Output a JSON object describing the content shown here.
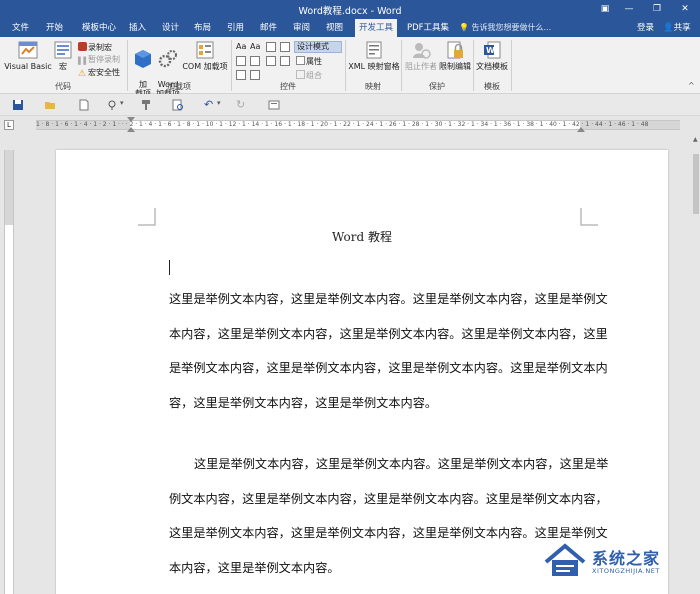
{
  "window": {
    "title": "Word教程.docx - Word"
  },
  "tabs": [
    {
      "label": "文件"
    },
    {
      "label": "开始"
    },
    {
      "label": "模板中心"
    },
    {
      "label": "插入"
    },
    {
      "label": "设计"
    },
    {
      "label": "布局"
    },
    {
      "label": "引用"
    },
    {
      "label": "邮件"
    },
    {
      "label": "审阅"
    },
    {
      "label": "视图"
    },
    {
      "label": "开发工具"
    },
    {
      "label": "PDF工具集"
    }
  ],
  "active_tab": "开发工具",
  "tell_me": "告诉我您想要做什么...",
  "account": {
    "login": "登录",
    "share": "共享"
  },
  "ribbon": {
    "code": {
      "label": "代码",
      "visual_basic": "Visual Basic",
      "macros": "宏",
      "record_macro": "录制宏",
      "pause_recording": "暂停录制",
      "macro_security": "宏安全性"
    },
    "addins": {
      "label": "加载项",
      "addins": "加\n载项",
      "word_addins": "Word\n加载项",
      "com_addins": "COM 加载项"
    },
    "controls": {
      "label": "控件",
      "design_mode": "设计模式",
      "properties": "属性",
      "group": "组合"
    },
    "mapping": {
      "label": "映射",
      "xml_mapping": "XML 映射窗格"
    },
    "protect": {
      "label": "保护",
      "block_authors": "阻止作者",
      "restrict_editing": "限制编辑"
    },
    "templates": {
      "label": "模板",
      "document_template": "文档模板"
    }
  },
  "ruler": {
    "h_ticks": "1 · 8 · 1 · 6 · 1 · 4 · 1 · 2 · 1 · · · 2 · 1 · 4 · 1 · 6 · 1 · 8 · 1 · 10 · 1 · 12 · 1 · 14 · 1 · 16 · 1 · 18 · 1 · 20 · 1 · 22 · 1 · 24 · 1 · 26 · 1 · 28 · 1 · 30 · 1 · 32 · 1 · 34 · 1 · 36 · 1 · 38 · 1 · 40 · 1 · 42 · 1 · 44 · 1 · 46 · 1 · 48",
    "corner": "L"
  },
  "document": {
    "title": "Word 教程",
    "paragraph1": "这里是举例文本内容，这里是举例文本内容。这里是举例文本内容，这里是举例文本内容，这里是举例文本内容，这里是举例文本内容。这里是举例文本内容，这里是举例文本内容，这里是举例文本内容，这里是举例文本内容。这里是举例文本内容，这里是举例文本内容，这里是举例文本内容。",
    "paragraph2": "这里是举例文本内容，这里是举例文本内容。这里是举例文本内容，这里是举例文本内容，这里是举例文本内容，这里是举例文本内容。这里是举例文本内容，这里是举例文本内容，这里是举例文本内容，这里是举例文本内容。这里是举例文本内容，这里是举例文本内容。"
  },
  "watermark": {
    "text": "系统之家",
    "sub": "XITONGZHIJIA.NET"
  },
  "colors": {
    "accent": "#2b579a",
    "ribbon_bg": "#f1f1f1",
    "canvas_bg": "#e6e6e6"
  }
}
